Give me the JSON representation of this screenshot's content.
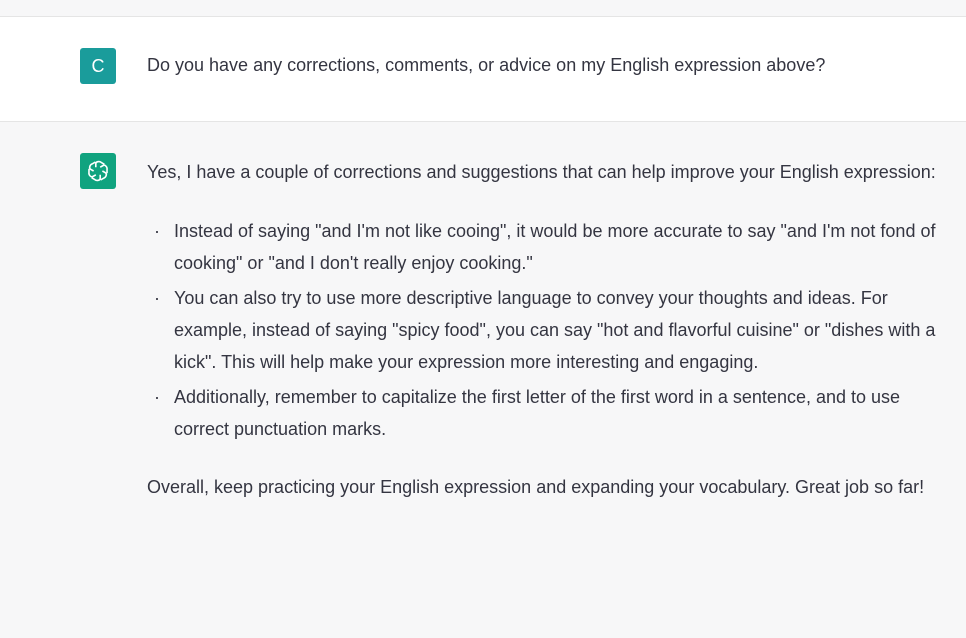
{
  "conversation": {
    "user_message": {
      "avatar_letter": "C",
      "avatar_color": "#1a9c9b",
      "text": "Do you have any corrections, comments, or advice on my English expression above?"
    },
    "assistant_message": {
      "avatar_icon": "openai-logo-icon",
      "avatar_color": "#10a37f",
      "intro": "Yes, I have a couple of corrections and suggestions that can help improve your English expression:",
      "bullets": [
        "Instead of saying \"and I'm not like cooing\", it would be more accurate to say \"and I'm not fond of cooking\" or \"and I don't really enjoy cooking.\"",
        "You can also try to use more descriptive language to convey your thoughts and ideas. For example, instead of saying \"spicy food\", you can say \"hot and flavorful cuisine\" or \"dishes with a kick\". This will help make your expression more interesting and engaging.",
        "Additionally, remember to capitalize the first letter of the first word in a sentence, and to use correct punctuation marks."
      ],
      "outro": "Overall, keep practicing your English expression and expanding your vocabulary. Great job so far!"
    }
  }
}
